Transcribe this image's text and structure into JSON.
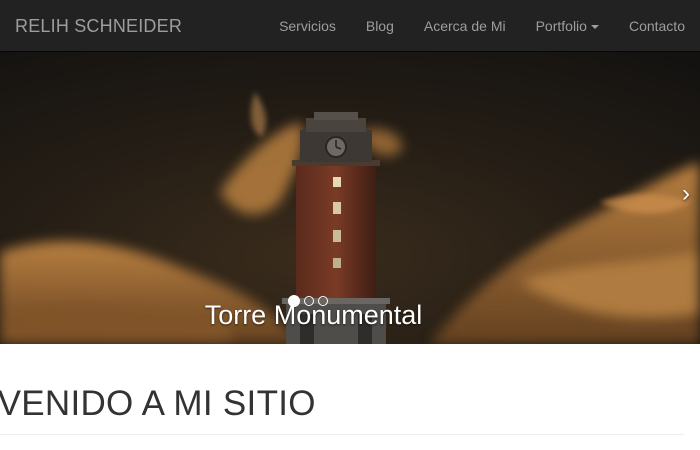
{
  "navbar": {
    "brand": "RELIH SCHNEIDER",
    "items": [
      {
        "label": "Servicios"
      },
      {
        "label": "Blog"
      },
      {
        "label": "Acerca de Mi"
      },
      {
        "label": "Portfolio",
        "dropdown": true
      },
      {
        "label": "Contacto"
      }
    ],
    "background": "#222222",
    "text_color": "#9d9d9d"
  },
  "carousel": {
    "caption": "Torre Monumental",
    "indicators": {
      "count": 3,
      "active": 1
    },
    "next_icon": "›"
  },
  "main": {
    "heading": "NVENIDO A MI SITIO"
  },
  "colors": {
    "heading": "#333333",
    "sky_dark": "#1a1712",
    "cloud": "#a06a32"
  }
}
